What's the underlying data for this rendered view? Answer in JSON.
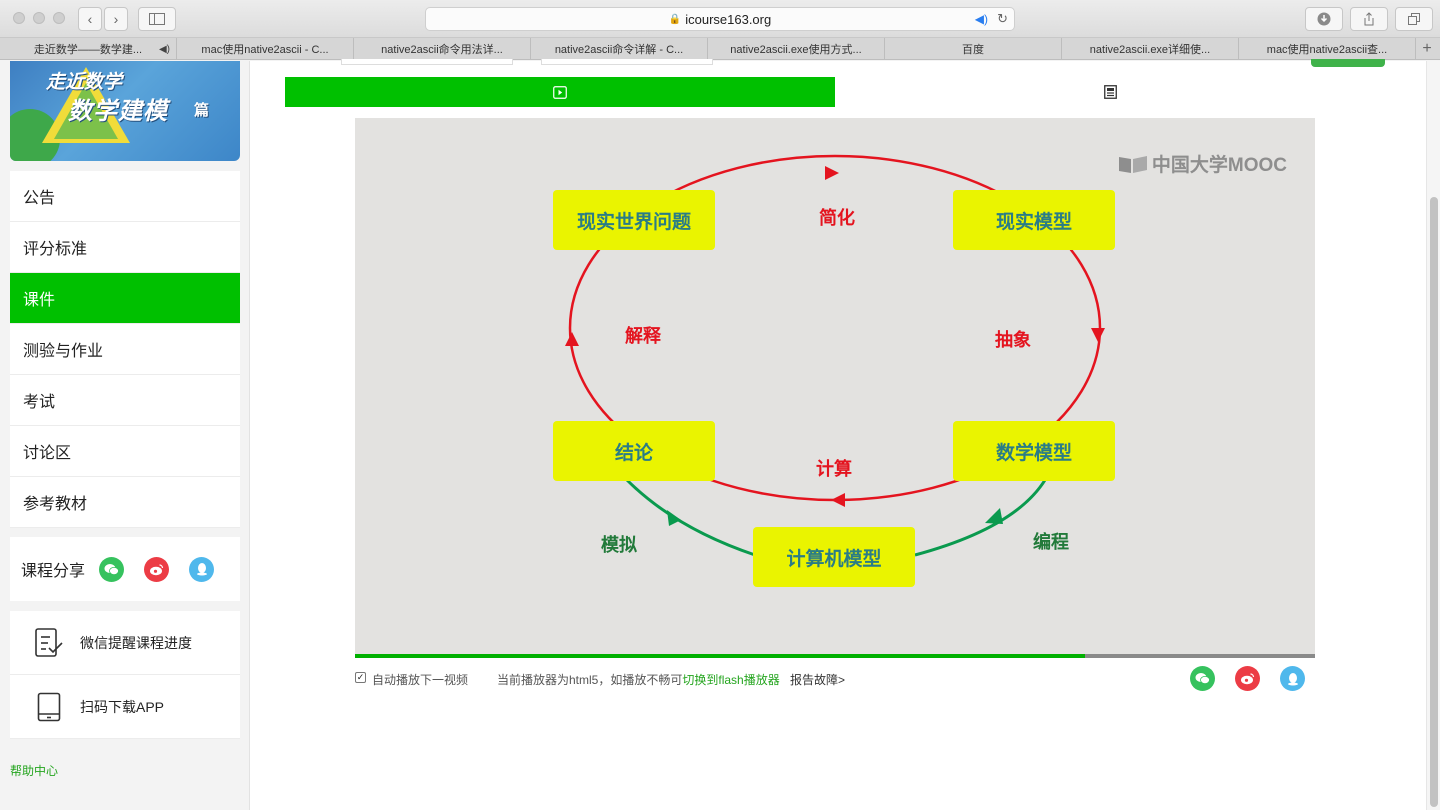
{
  "browser": {
    "url": "icourse163.org",
    "tabs": [
      {
        "label": "走近数学——数学建...",
        "audio": true
      },
      {
        "label": "mac使用native2ascii - C..."
      },
      {
        "label": "native2ascii命令用法详..."
      },
      {
        "label": "native2ascii命令详解 - C..."
      },
      {
        "label": "native2ascii.exe使用方式..."
      },
      {
        "label": "百度"
      },
      {
        "label": "native2ascii.exe详细使..."
      },
      {
        "label": "mac使用native2ascii查..."
      }
    ],
    "new_tab": "+"
  },
  "course_banner": {
    "line1": "走近数学",
    "line2": "数学建模",
    "line3": "篇"
  },
  "menu": {
    "items": [
      {
        "label": "公告"
      },
      {
        "label": "评分标准"
      },
      {
        "label": "课件",
        "active": true
      },
      {
        "label": "测验与作业"
      },
      {
        "label": "考试"
      },
      {
        "label": "讨论区"
      },
      {
        "label": "参考教材"
      }
    ]
  },
  "share": {
    "label": "课程分享"
  },
  "utils": {
    "wechat_remind": "微信提醒课程进度",
    "download_app": "扫码下载APP"
  },
  "help": "帮助中心",
  "video": {
    "watermark": "中国大学MOOC",
    "boxes": {
      "real_problem": "现实世界问题",
      "real_model": "现实模型",
      "math_model": "数学模型",
      "conclusion": "结论",
      "computer_model": "计算机模型"
    },
    "arrows": {
      "simplify": "简化",
      "abstract": "抽象",
      "compute": "计算",
      "interpret": "解释",
      "program": "编程",
      "simulate": "模拟"
    },
    "progress": 0.76
  },
  "below_video": {
    "autoplay": "自动播放下一视频",
    "status_prefix": "当前播放器为html5，如播放不畅可",
    "switch_link": "切换到flash播放器",
    "report": "报告故障>"
  },
  "colors": {
    "accent": "#00c000",
    "link": "#25a51f",
    "box_fill": "#eaf400",
    "box_text": "#2a7c86",
    "red_arrow": "#e4141f",
    "green_arrow": "#0a9a4e"
  }
}
